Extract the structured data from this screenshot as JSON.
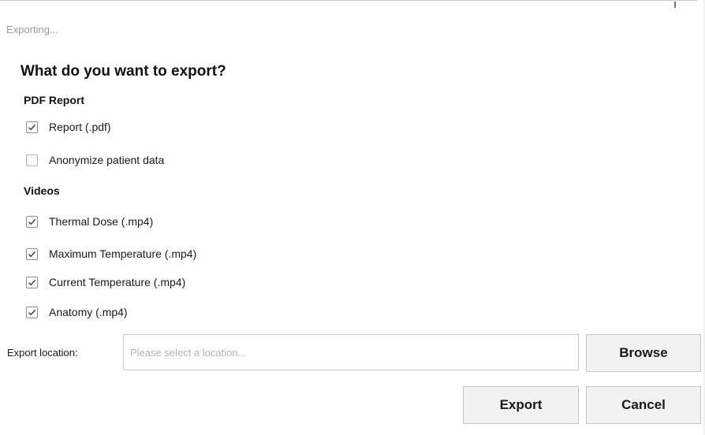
{
  "window": {
    "status": "Exporting..."
  },
  "dialog": {
    "question": "What do you want to export?"
  },
  "pdf_section": {
    "title": "PDF Report",
    "options": [
      {
        "label": "Report (.pdf)",
        "checked": true
      },
      {
        "label": "Anonymize patient data",
        "checked": false
      }
    ]
  },
  "video_section": {
    "title": "Videos",
    "options": [
      {
        "label": "Thermal Dose (.mp4)",
        "checked": true
      },
      {
        "label": "Maximum Temperature (.mp4)",
        "checked": true
      },
      {
        "label": "Current Temperature (.mp4)",
        "checked": true
      },
      {
        "label": "Anatomy (.mp4)",
        "checked": true
      }
    ]
  },
  "export_location": {
    "label": "Export location:",
    "value": "",
    "placeholder": "Please select a location...",
    "browse_label": "Browse"
  },
  "actions": {
    "export_label": "Export",
    "cancel_label": "Cancel"
  },
  "icons": {
    "checkmark": "checkmark-icon"
  }
}
